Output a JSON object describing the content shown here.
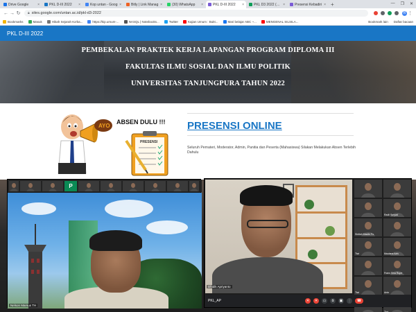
{
  "browser": {
    "tabs": [
      {
        "title": "Drive Google",
        "color": "#1a73e8",
        "active": false
      },
      {
        "title": "PKL D-III 2022",
        "color": "#1976c5",
        "active": false
      },
      {
        "title": "Kop untan - Goog",
        "color": "#4285f4",
        "active": false
      },
      {
        "title": "Bitly | Link Manag",
        "color": "#ee6123",
        "active": false
      },
      {
        "title": "(30) WhatsApp",
        "color": "#25d366",
        "active": false
      },
      {
        "title": "PKL D-III 2022",
        "color": "#7b5cd6",
        "active": true
      },
      {
        "title": "PKL D3 2022 (Jaw",
        "color": "#0f9d58",
        "active": false
      },
      {
        "title": "Presensi Kebadiri",
        "color": "#7b5cd6",
        "active": false
      }
    ],
    "new_tab": "+",
    "window_controls": [
      "—",
      "❐",
      "✕"
    ],
    "url": "sites.google.com/untan.ac.id/pkl-d3-2022",
    "bookmarks": [
      {
        "label": "Bookmarks",
        "color": "#f4b400"
      },
      {
        "label": "Masuk",
        "color": "#34a853"
      },
      {
        "label": "Hikah Sejarah Ka'ba...",
        "color": "#777"
      },
      {
        "label": "https://kip.umum-...",
        "color": "#4285f4"
      },
      {
        "label": "NASQL | Notebooks...",
        "color": "#555"
      },
      {
        "label": "Twitter",
        "color": "#1da1f2"
      },
      {
        "label": "Kajian Umum : Bukt...",
        "color": "#ff0000"
      },
      {
        "label": "Mari belajar ABC ~...",
        "color": "#1877f2"
      },
      {
        "label": "MENGENAL SILSILA...",
        "color": "#ff0000"
      }
    ],
    "bookmarks_right": [
      "Bookmark lain",
      "Daftar bacaan"
    ],
    "profile_initial": "R"
  },
  "site": {
    "header_title": "PKL D-III 2022",
    "hero_lines": [
      "PEMBEKALAN PRAKTEK KERJA LAPANGAN PROGRAM DIPLOMA III",
      "FAKULTAS ILMU SOSIAL DAN ILMU POLITIK",
      "UNIVERSITAS TANJUNGPURA TAHUN 2022"
    ],
    "absen_callout": "AYO",
    "absen_title": "ABSEN DULU !!!",
    "absen_board": "PRESENSI",
    "presensi_title": "PRESENSI ONLINE",
    "presensi_desc": "Seluruh Pemateri, Moderator, Admin, Panitia dan Peserta (Mahasiswa) Silakan Melakukan Absen Terlebih Dahulu"
  },
  "meeting_left": {
    "thumb_letter": "P",
    "speaker_name": "Nelson Marsus TH"
  },
  "meeting_right": {
    "speaker_name": "Dhidik Apriyanto",
    "meeting_name": "PKL_AP",
    "participants": [
      "",
      "",
      "",
      "Radii Suryad",
      "Sintiah Maulin Fo.",
      "",
      "Tiwi",
      "Maulana Azis",
      "",
      "Frans Sina Rupe",
      "Tiwi",
      "Anin",
      "",
      "Tiwi"
    ],
    "controls": [
      "mic-off",
      "camera-off",
      "captions",
      "raise-hand",
      "present",
      "more",
      "end-call"
    ]
  }
}
